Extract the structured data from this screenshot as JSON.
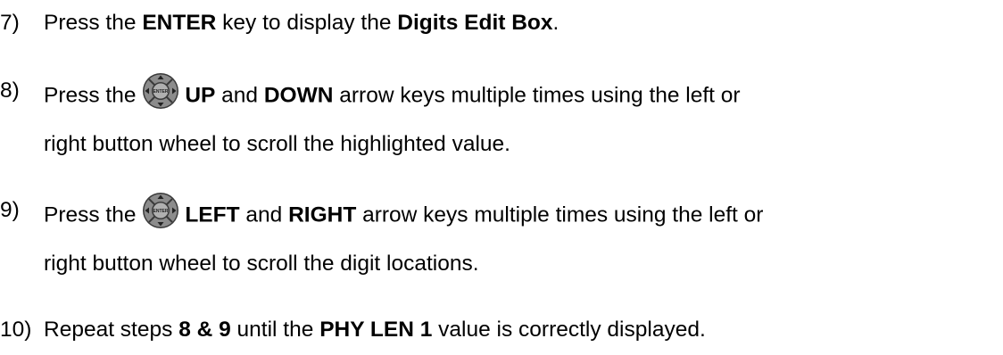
{
  "steps": [
    {
      "number": "7)",
      "parts": [
        "Press the ",
        "ENTER",
        " key to display the ",
        "Digits Edit Box",
        "."
      ]
    },
    {
      "number": "8)",
      "parts": [
        " Press the ",
        "UP",
        " and ",
        "DOWN",
        " arrow keys multiple times using the left or"
      ],
      "continuation": "right button wheel to scroll the highlighted value.",
      "icon": "directional-pad-icon"
    },
    {
      "number": "9)",
      "parts": [
        "Press the ",
        "LEFT",
        " and ",
        "RIGHT",
        " arrow keys multiple times using the left or"
      ],
      "continuation": "right button wheel to scroll the digit locations.",
      "icon": "directional-pad-icon"
    },
    {
      "number": "10)",
      "parts": [
        "Repeat steps ",
        "8 & 9",
        " until the ",
        "PHY LEN 1",
        " value is correctly displayed."
      ]
    }
  ],
  "icon_center_label": "ENTER",
  "colors": {
    "text": "#000000",
    "icon_dark": "#3a3a3a",
    "icon_light": "#9a9a9a",
    "background": "#ffffff"
  }
}
